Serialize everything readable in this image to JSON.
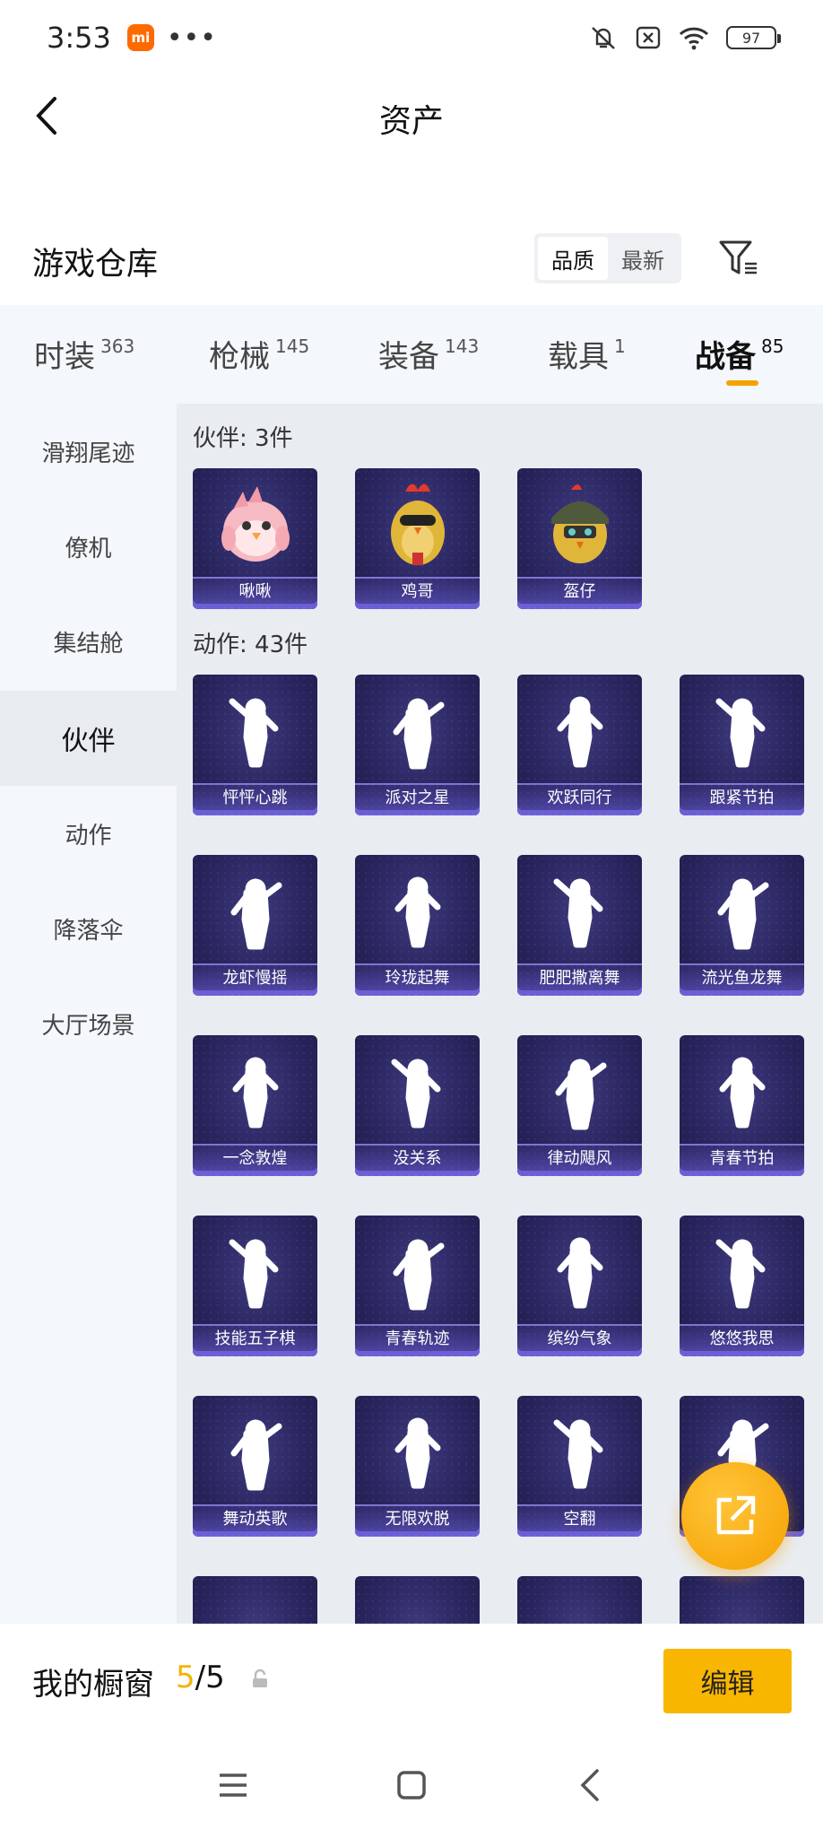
{
  "status_bar": {
    "time": "3:53",
    "app_badge": "mi",
    "more": "•••",
    "battery": "97"
  },
  "header": {
    "title": "资产"
  },
  "warehouse": {
    "title": "游戏仓库",
    "sort_options": [
      "品质",
      "最新"
    ],
    "active_sort": "品质"
  },
  "tabs": [
    {
      "label": "时装",
      "count": "363"
    },
    {
      "label": "枪械",
      "count": "145"
    },
    {
      "label": "装备",
      "count": "143"
    },
    {
      "label": "载具",
      "count": "1"
    },
    {
      "label": "战备",
      "count": "85"
    }
  ],
  "active_tab": "战备",
  "sidebar": {
    "items": [
      "滑翔尾迹",
      "僚机",
      "集结舱",
      "伙伴",
      "动作",
      "降落伞",
      "大厅场景"
    ],
    "active": "伙伴"
  },
  "sections": {
    "companions": {
      "title": "伙伴: 3件",
      "items": [
        "啾啾",
        "鸡哥",
        "盔仔"
      ]
    },
    "emotes": {
      "title": "动作: 43件",
      "items": [
        "怦怦心跳",
        "派对之星",
        "欢跃同行",
        "跟紧节拍",
        "龙虾慢摇",
        "玲珑起舞",
        "肥肥撒离舞",
        "流光鱼龙舞",
        "一念敦煌",
        "没关系",
        "律动飓风",
        "青春节拍",
        "技能五子棋",
        "青春轨迹",
        "缤纷气象",
        "悠悠我思",
        "舞动英歌",
        "无限欢脱",
        "空翻",
        ""
      ]
    }
  },
  "showcase": {
    "label": "我的橱窗",
    "current": "5",
    "total": "/5",
    "edit_label": "编辑"
  },
  "colors": {
    "accent": "#f5a200",
    "card_bg": "#2a2660",
    "card_stripe": "#6b5fd6",
    "page_bg": "#e9edf2"
  }
}
